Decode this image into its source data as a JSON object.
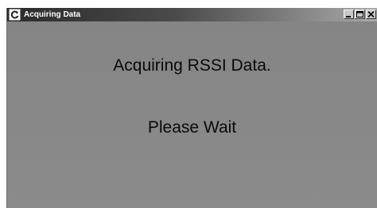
{
  "window": {
    "title": "Acquiring Data",
    "icons": {
      "app": "app-icon",
      "minimize": "minimize-icon",
      "maximize": "maximize-icon",
      "close": "close-icon"
    }
  },
  "content": {
    "status_message": "Acquiring RSSI Data.",
    "wait_message": "Please Wait"
  },
  "colors": {
    "client_background": "#888888",
    "title_bar_start": "#2b2b2b",
    "title_bar_end": "#a9a9a9",
    "text": "#0a0a0a"
  }
}
